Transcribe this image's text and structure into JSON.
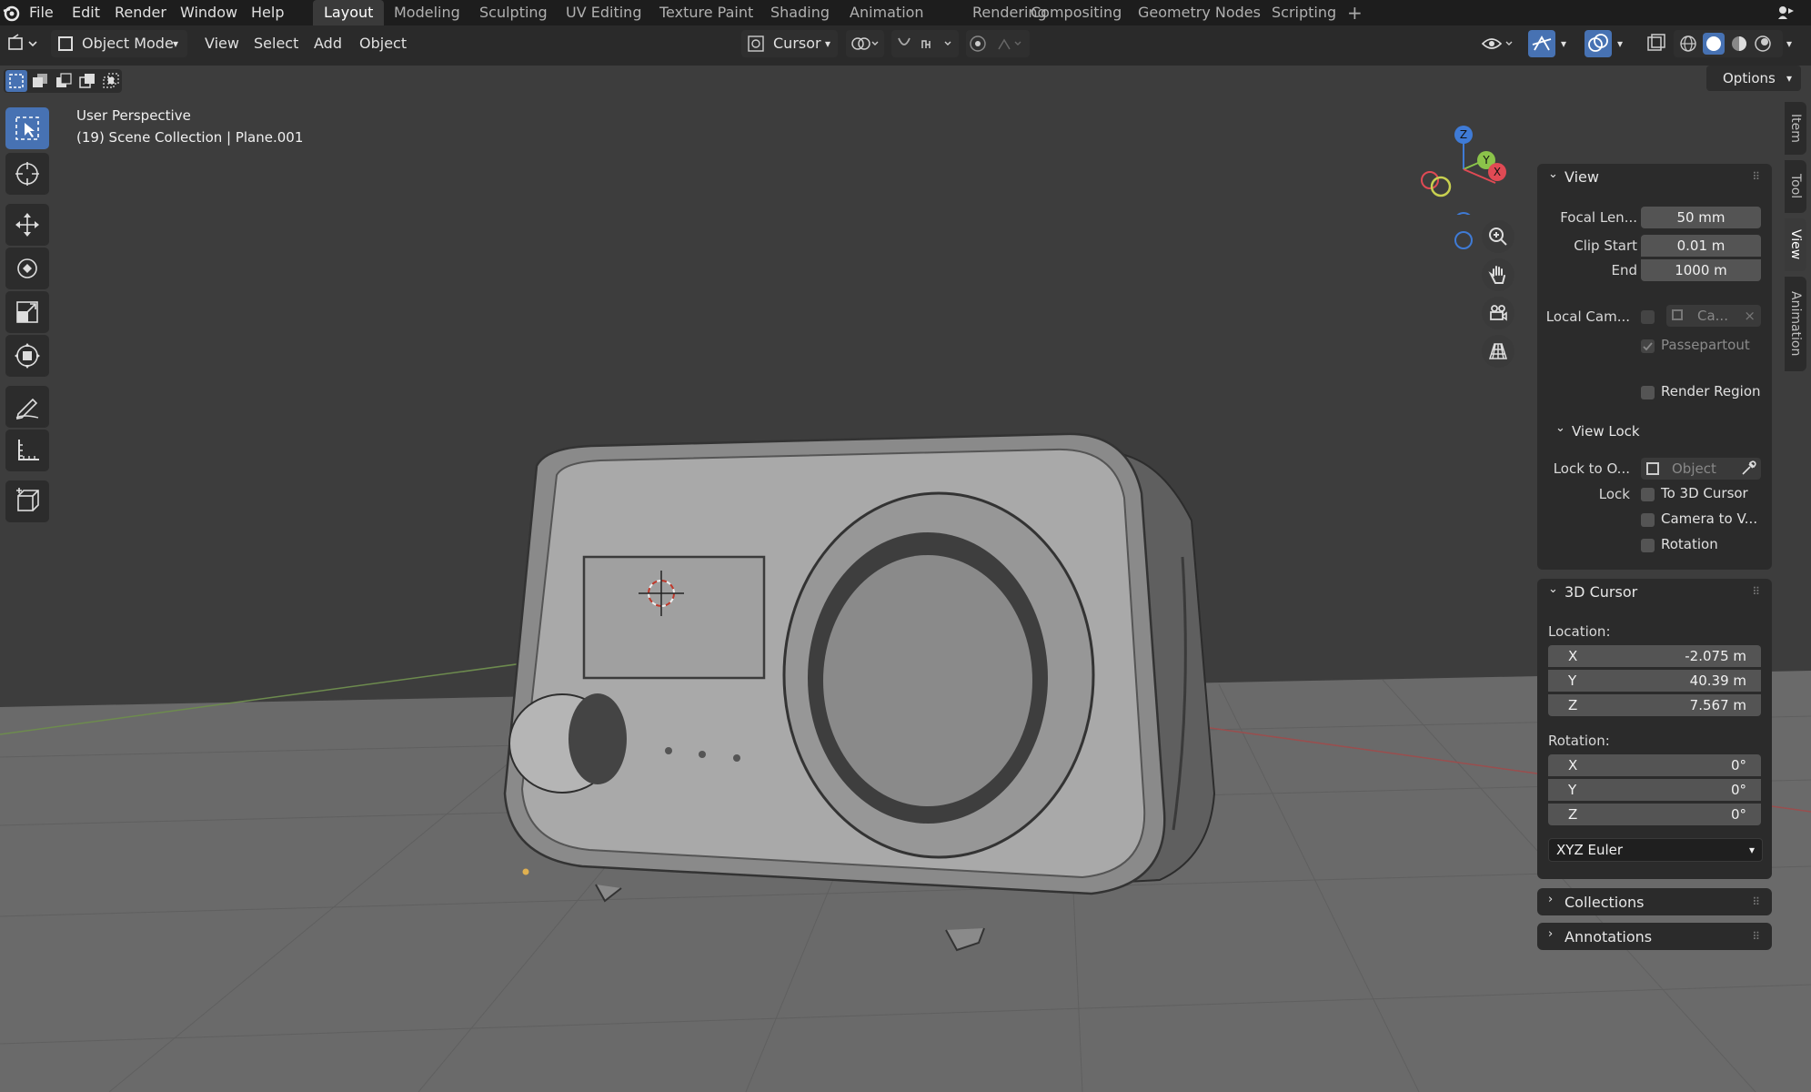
{
  "menu": {
    "file": "File",
    "edit": "Edit",
    "render": "Render",
    "window": "Window",
    "help": "Help"
  },
  "workspaces": [
    "Layout",
    "Modeling",
    "Sculpting",
    "UV Editing",
    "Texture Paint",
    "Shading",
    "Animation",
    "Rendering",
    "Compositing",
    "Geometry Nodes",
    "Scripting"
  ],
  "active_workspace": "Layout",
  "add_workspace": "+",
  "header": {
    "mode": "Object Mode",
    "view": "View",
    "select": "Select",
    "add": "Add",
    "object": "Object",
    "transform_pivot": "Cursor",
    "options": "Options"
  },
  "viewport": {
    "perspective": "User Perspective",
    "collection_info": "(19) Scene Collection | Plane.001",
    "gizmo": {
      "z": "Z",
      "y": "Y",
      "x": "X"
    }
  },
  "npanel": {
    "view": {
      "title": "View",
      "focal_length_label": "Focal Len...",
      "focal_length": "50 mm",
      "clip_start_label": "Clip Start",
      "clip_start": "0.01 m",
      "clip_end_label": "End",
      "clip_end": "1000 m",
      "local_camera_label": "Local Cam...",
      "local_camera_value": "Ca...",
      "passepartout": "Passepartout",
      "render_region": "Render Region",
      "view_lock_title": "View Lock",
      "lock_to_label": "Lock to O...",
      "lock_to_placeholder": "Object",
      "lock_label": "Lock",
      "to_3d_cursor": "To 3D Cursor",
      "camera_to_view": "Camera to V...",
      "rotation": "Rotation"
    },
    "cursor": {
      "title": "3D Cursor",
      "location_label": "Location:",
      "loc": [
        {
          "axis": "X",
          "value": "-2.075 m"
        },
        {
          "axis": "Y",
          "value": "40.39 m"
        },
        {
          "axis": "Z",
          "value": "7.567 m"
        }
      ],
      "rotation_label": "Rotation:",
      "rot": [
        {
          "axis": "X",
          "value": "0°"
        },
        {
          "axis": "Y",
          "value": "0°"
        },
        {
          "axis": "Z",
          "value": "0°"
        }
      ],
      "rotation_mode": "XYZ Euler"
    },
    "collections": "Collections",
    "annotations": "Annotations",
    "tabs": [
      "Item",
      "Tool",
      "View",
      "Animation"
    ],
    "active_tab": "View"
  },
  "colors": {
    "accent": "#4772b3",
    "axis_x": "#e04a54",
    "axis_y": "#8bc34a",
    "axis_z": "#3f7bd6"
  }
}
